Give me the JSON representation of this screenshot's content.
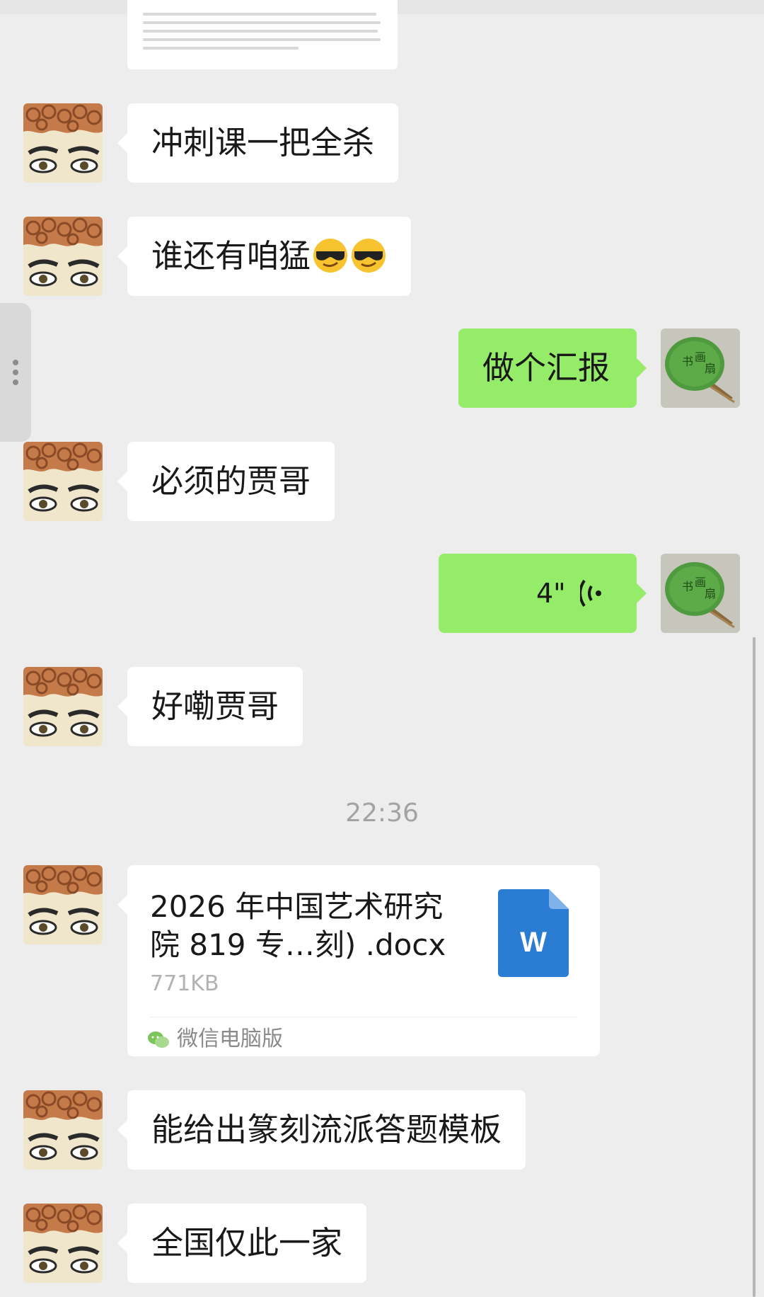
{
  "messages": [
    {
      "text": "冲刺课一把全杀"
    },
    {
      "text": "谁还有咱猛",
      "emoji": [
        "smiling-face-with-sunglasses-icon",
        "smiling-face-with-sunglasses-icon"
      ]
    },
    {
      "text": "做个汇报"
    },
    {
      "text": "必须的贾哥"
    },
    {
      "voice_duration": "4\""
    },
    {
      "text": "好嘞贾哥"
    },
    {
      "timestamp": "22:36"
    },
    {
      "file": {
        "name": "2026 年中国艺术研究院 819 专…刻) .docx",
        "size": "771KB",
        "source": "微信电脑版",
        "icon": "word-doc-icon"
      }
    },
    {
      "text": "能给出篆刻流派答题模板"
    },
    {
      "text": "全国仅此一家"
    }
  ],
  "colors": {
    "background": "#ededed",
    "incoming_bubble": "#ffffff",
    "outgoing_bubble": "#95ec69",
    "timestamp_text": "#a3a3a3",
    "word_blue": "#2b7cd3"
  }
}
